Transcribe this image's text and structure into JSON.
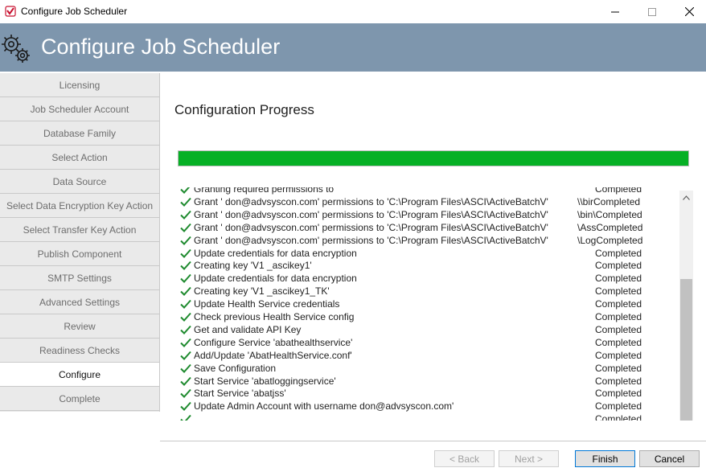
{
  "window": {
    "title": "Configure Job Scheduler",
    "icon": "app-logo-icon",
    "controls": {
      "minimize": "minimize-icon",
      "maximize": "maximize-icon",
      "close": "close-icon"
    }
  },
  "banner": {
    "title": "Configure Job Scheduler",
    "icon": "gears-icon",
    "color": "#7e96ad"
  },
  "sidebar": {
    "items": [
      {
        "label": "Licensing"
      },
      {
        "label": "Job Scheduler Account"
      },
      {
        "label": "Database Family"
      },
      {
        "label": "Select Action"
      },
      {
        "label": "Data Source"
      },
      {
        "label": "Select Data Encryption Key Action"
      },
      {
        "label": "Select Transfer Key Action"
      },
      {
        "label": "Publish Component"
      },
      {
        "label": "SMTP Settings"
      },
      {
        "label": "Advanced Settings"
      },
      {
        "label": "Review"
      },
      {
        "label": "Readiness Checks"
      },
      {
        "label": "Configure",
        "active": true
      },
      {
        "label": "Complete"
      }
    ]
  },
  "main": {
    "title": "Configuration Progress",
    "progress": {
      "percent": 100,
      "color": "#06b025"
    },
    "log": [
      {
        "message": "Granting required permissions to",
        "path": "",
        "status": "Completed"
      },
      {
        "message": "Grant '           don@advsyscon.com' permissions to 'C:\\Program Files\\ASCI\\ActiveBatchV'",
        "path": "\\\\birCompleted",
        "status": ""
      },
      {
        "message": "Grant '           don@advsyscon.com' permissions to 'C:\\Program Files\\ASCI\\ActiveBatchV'",
        "path": "\\bin\\Completed",
        "status": ""
      },
      {
        "message": "Grant '           don@advsyscon.com' permissions to 'C:\\Program Files\\ASCI\\ActiveBatchV'",
        "path": "\\AssCompleted",
        "status": ""
      },
      {
        "message": "Grant '           don@advsyscon.com' permissions to 'C:\\Program Files\\ASCI\\ActiveBatchV'",
        "path": "\\LogCompleted",
        "status": ""
      },
      {
        "message": "Update credentials for data encryption",
        "path": "",
        "status": "Completed"
      },
      {
        "message": "Creating key 'V1            _ascikey1'",
        "path": "",
        "status": "Completed"
      },
      {
        "message": "Update credentials for data encryption",
        "path": "",
        "status": "Completed"
      },
      {
        "message": "Creating key 'V1            _ascikey1_TK'",
        "path": "",
        "status": "Completed"
      },
      {
        "message": "Update Health Service credentials",
        "path": "",
        "status": "Completed"
      },
      {
        "message": "Check previous Health Service config",
        "path": "",
        "status": "Completed"
      },
      {
        "message": "Get and validate API Key",
        "path": "",
        "status": "Completed"
      },
      {
        "message": "Configure Service 'abathealthservice'",
        "path": "",
        "status": "Completed"
      },
      {
        "message": "Add/Update 'AbatHealthService.conf'",
        "path": "",
        "status": "Completed"
      },
      {
        "message": "Save Configuration",
        "path": "",
        "status": "Completed"
      },
      {
        "message": "Start Service 'abatloggingservice'",
        "path": "",
        "status": "Completed"
      },
      {
        "message": "Start Service 'abatjss'",
        "path": "",
        "status": "Completed"
      },
      {
        "message": "Update Admin Account with username              don@advsyscon.com'",
        "path": "",
        "status": "Completed"
      },
      {
        "message": "",
        "path": "",
        "status": "Completed"
      }
    ]
  },
  "footer": {
    "back": "< Back",
    "next": "Next >",
    "finish": "Finish",
    "cancel": "Cancel"
  }
}
